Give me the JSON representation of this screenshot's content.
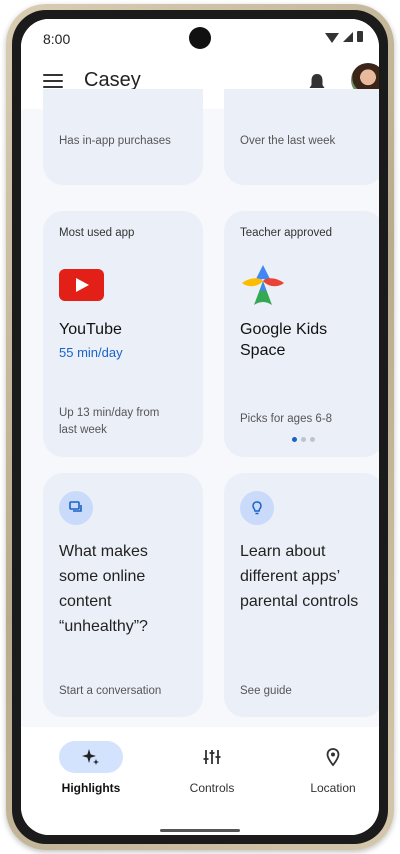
{
  "status": {
    "time": "8:00"
  },
  "header": {
    "title": "Casey"
  },
  "cards": {
    "top_left_foot": "Has in-app purchases",
    "top_right_foot": "Over the last week",
    "most_used": {
      "label": "Most used app",
      "app": "YouTube",
      "usage": "55 min/day",
      "foot_line1": "Up 13 min/day from",
      "foot_line2": "last week"
    },
    "teacher": {
      "label": "Teacher approved",
      "app_line1": "Google Kids",
      "app_line2": "Space",
      "foot": "Picks for ages 6-8"
    },
    "conversation": {
      "q1": "What makes",
      "q2": "some online",
      "q3": "content",
      "q4": "“unhealthy”?",
      "foot": "Start a conversation"
    },
    "guide": {
      "q1": "Learn about",
      "q2": "different apps’",
      "q3": "parental controls",
      "foot": "See guide"
    }
  },
  "nav": {
    "highlights": "Highlights",
    "controls": "Controls",
    "location": "Location"
  },
  "colors": {
    "accent": "#1a62c7",
    "card_bg": "#ebf0f8",
    "nav_active": "#d3e3fd",
    "youtube_red": "#e22018"
  },
  "icons": [
    "menu-icon",
    "bell-icon",
    "youtube-icon",
    "kids-space-icon",
    "chat-icon",
    "lightbulb-icon",
    "sparkle-icon",
    "sliders-icon",
    "location-pin-icon"
  ]
}
